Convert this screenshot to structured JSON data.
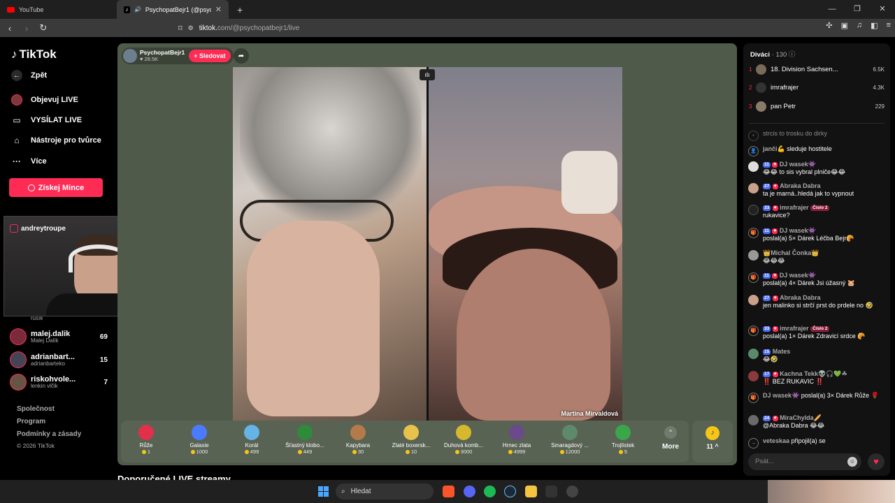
{
  "browser": {
    "tabs": [
      {
        "title": "YouTube",
        "icon": "youtube-icon",
        "active": false
      },
      {
        "title": "PsychopatBejr1 (@psychopat",
        "icon": "tiktok-icon",
        "active": true
      }
    ],
    "url_prefix": "tiktok.",
    "url_rest": "com/@psychopatbejr1/live"
  },
  "sidebar": {
    "logo": "TikTok",
    "back": "Zpět",
    "nav": [
      {
        "label": "Objevuj LIVE",
        "icon": "live-discover-icon"
      },
      {
        "label": "VYSÍLAT LIVE",
        "icon": "camera-icon"
      },
      {
        "label": "Nástroje pro tvůrce",
        "icon": "home-tools-icon"
      },
      {
        "label": "Více",
        "icon": "more-dots-icon"
      }
    ],
    "coins_button": "Získej Mince",
    "partial_user": "rusík",
    "following": [
      {
        "name": "malej.dalik",
        "sub": "Malej Dalík",
        "count": "69"
      },
      {
        "name": "adrianbart...",
        "sub": "adrianbarteko",
        "count": "15"
      },
      {
        "name": "riskohvole...",
        "sub": "lenkin vlčik",
        "count": "7"
      }
    ],
    "footer": [
      "Společnost",
      "Program",
      "Podmínky a zásady"
    ],
    "copyright": "© 2026 TikTok"
  },
  "webcam": {
    "handle": "andreytroupe"
  },
  "live": {
    "host_name": "PsychopatBejr1",
    "host_likes": "28.5K",
    "follow_label": "+ Sledovat",
    "guest_name": "Martina Mirvaldová",
    "gifts": [
      {
        "name": "Růže",
        "price": "1",
        "color": "#e0304a"
      },
      {
        "name": "Galaxie",
        "price": "1000",
        "color": "#4a7bff"
      },
      {
        "name": "Korál",
        "price": "499",
        "color": "#66b3e6"
      },
      {
        "name": "Šťastný klobo...",
        "price": "449",
        "color": "#2f8a3a"
      },
      {
        "name": "Kapybara",
        "price": "30",
        "color": "#b57a4a"
      },
      {
        "name": "Zlaté boxersk...",
        "price": "10",
        "color": "#e8c24a"
      },
      {
        "name": "Duhová komb...",
        "price": "3000",
        "color": "#d6b82e"
      },
      {
        "name": "Hrnec zlata",
        "price": "4999",
        "color": "#6a4a8a"
      },
      {
        "name": "Smaragdový ...",
        "price": "12000",
        "color": "#5c8a6a"
      },
      {
        "name": "Trojlístek",
        "price": "5",
        "color": "#3aa64a"
      }
    ],
    "more_label": "More",
    "coin_count": "11"
  },
  "recommended": "Doporučené LIVE streamy",
  "chat": {
    "viewers_label": "Diváci",
    "viewers_count": "· 130",
    "top_viewers": [
      {
        "rank": "1",
        "name": "18. Division Sachsen...",
        "score": "6.5K",
        "color": "#7a6a5a"
      },
      {
        "rank": "2",
        "name": "imrafrajer",
        "score": "4.3K",
        "color": "#222"
      },
      {
        "rank": "3",
        "name": "pan Petr",
        "score": "229",
        "color": "#8a7a6a"
      }
    ],
    "messages": [
      {
        "user": "",
        "text": "strcis to trosku do dirky",
        "type": "faded"
      },
      {
        "user": "janči💪",
        "text": "sleduje hostitele",
        "type": "system"
      },
      {
        "user": "DJ wasek👾",
        "level": "11",
        "text": "😂😂 to sis vybral plniče😂😂",
        "type": "user",
        "color": "#ddd"
      },
      {
        "user": "Abraka Dabra",
        "level": "27",
        "text": "ta je marná..hledá jak to vypnout",
        "type": "user",
        "color": "#c9a08a"
      },
      {
        "user": "imrafrajer",
        "level": "33",
        "badge": "Číslo 2",
        "text": "rukavice?",
        "type": "user",
        "color": "#222"
      },
      {
        "user": "DJ wasek👾",
        "level": "11",
        "text": "poslal(a) 5× Dárek Léčba Bejr🥐",
        "type": "gift"
      },
      {
        "user": "👑Michal Čonka👑",
        "text": "😂😂😂",
        "type": "user",
        "color": "#999"
      },
      {
        "user": "DJ wasek👾",
        "level": "11",
        "text": "poslal(a) 4× Dárek Jsi úžasný 🐹",
        "type": "gift"
      },
      {
        "user": "Abraka Dabra",
        "level": "27",
        "text": "jen malinko si strčí prst do prdele no 🤣",
        "type": "user",
        "color": "#c9a08a"
      },
      {
        "user": "imrafrajer",
        "level": "33",
        "badge": "Číslo 2",
        "text": "poslal(a) 1× Dárek Zdravicí srdce 🥐",
        "type": "gift"
      },
      {
        "user": "Mates",
        "level": "15",
        "text": "😂🤣",
        "type": "user",
        "color": "#5a8a6a"
      },
      {
        "user": "Kachna Tekk👽🎧💚☘",
        "level": "17",
        "text": "‼️ BEZ RUKAVIC ‼️",
        "type": "user",
        "color": "#8a3a3a"
      },
      {
        "user": "DJ wasek👾",
        "text": "poslal(a) 3× Dárek Růže 🌹",
        "type": "gift"
      },
      {
        "user": "MiraChylda🥖",
        "level": "24",
        "text": "@Abraka Dabra 😂😂",
        "type": "user",
        "color": "#6a6a6a"
      },
      {
        "user": "veteskaa",
        "text": "připojil(a) se",
        "type": "system"
      }
    ],
    "input_placeholder": "Psát..."
  },
  "taskbar": {
    "search": "Hledat"
  }
}
